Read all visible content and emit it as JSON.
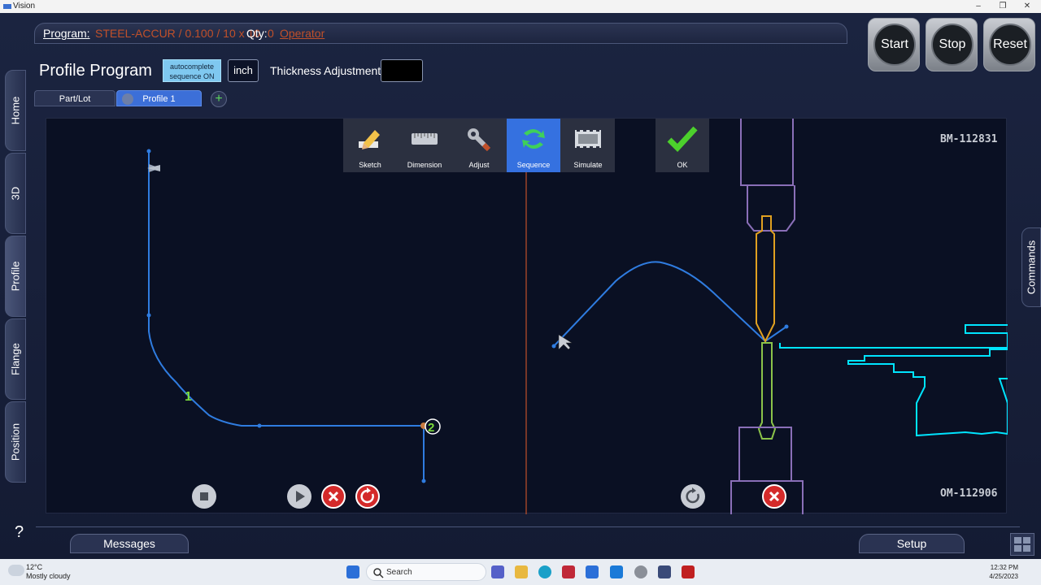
{
  "window": {
    "title": "Vision",
    "minimize": "–",
    "maximize": "❐",
    "close": "✕"
  },
  "program_bar": {
    "program_label": "Program:",
    "program_value": "STEEL-ACCUR / 0.100 / 10 x 10",
    "qty_label": "Qty:",
    "qty_value": "0",
    "operator_link": "Operator"
  },
  "header": {
    "page_title": "Profile Program",
    "autocomplete_line1": "autocomplete",
    "autocomplete_line2": "sequence ON",
    "unit": "inch",
    "thickness_label": "Thickness Adjustment",
    "thickness_value": ""
  },
  "machine_buttons": {
    "start": "Start",
    "stop": "Stop",
    "reset": "Reset"
  },
  "tabs": [
    {
      "label": "Part/Lot"
    },
    {
      "label": "Profile 1"
    }
  ],
  "side_tabs": [
    "Home",
    "3D",
    "Profile",
    "Flange",
    "Position"
  ],
  "active_side_tab": "Profile",
  "help": "?",
  "commands_label": "Commands",
  "toolbar": [
    {
      "label": "Sketch",
      "icon": "pencil-icon"
    },
    {
      "label": "Dimension",
      "icon": "ruler-icon"
    },
    {
      "label": "Adjust",
      "icon": "wrench-icon"
    },
    {
      "label": "Sequence",
      "icon": "sequence-icon",
      "active": true
    },
    {
      "label": "Simulate",
      "icon": "film-icon"
    }
  ],
  "ok_label": "OK",
  "machine_ids": {
    "top": "BM-112831",
    "bottom": "OM-112906"
  },
  "bend_markers": [
    "1",
    "2"
  ],
  "messages_label": "Messages",
  "setup_label": "Setup",
  "colors": {
    "active_blue": "#3571e0",
    "profile_line": "#2f7ce0",
    "orange": "#c0502a",
    "tool_yellow": "#e0a020",
    "tool_green": "#8bc34a",
    "cyan": "#00e5ff",
    "die_purple": "#8a6fb8"
  },
  "taskbar": {
    "weather_temp": "12°C",
    "weather_desc": "Mostly cloudy",
    "search": "Search",
    "time": "12:32 PM",
    "date": "4/25/2023"
  }
}
